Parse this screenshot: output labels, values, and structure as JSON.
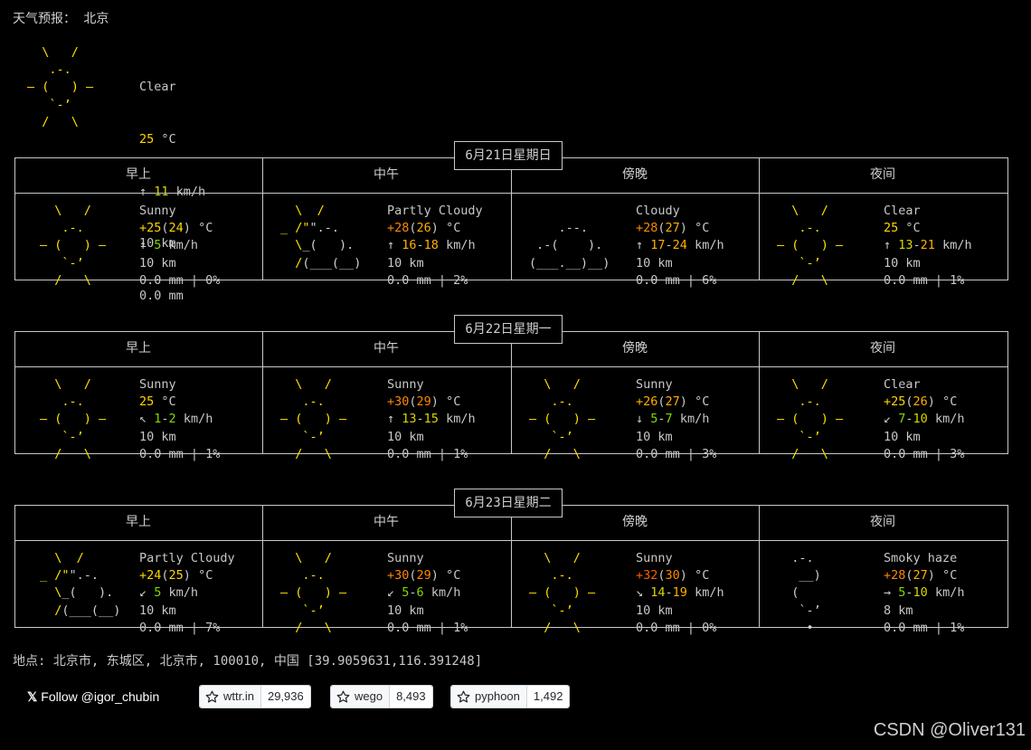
{
  "title": "天气预报： 北京",
  "current": {
    "art": [
      "  \\   /  ",
      "   .-.   ",
      "― (   ) ―",
      "   `-’   ",
      "  /   \\  "
    ],
    "condition": "Clear",
    "temp": "25",
    "temp_unit": " °C",
    "wind_arrow": "↑ ",
    "wind": "11",
    "wind_unit": " km/h",
    "visibility": "10 km",
    "precip": "0.0 mm"
  },
  "periods": [
    "早上",
    "中午",
    "傍晚",
    "夜间"
  ],
  "days": [
    {
      "date": "6月21日星期日",
      "slots": [
        {
          "art": [
            "  \\   /  ",
            "   .-.   ",
            "― (   ) ―",
            "   `-’   ",
            "  /   \\  "
          ],
          "art_color": "yellow",
          "cond": "Sunny",
          "t1": "+25",
          "t2": "24",
          "t1c": "c-t25",
          "t2c": "c-t24",
          "unit": " °C",
          "arrow": "↑ ",
          "w1": "5",
          "w2": "",
          "wc1": "w-lo",
          "wc2": "",
          "wunit": " km/h",
          "vis": "10 km",
          "prec": "0.0 mm | 0%"
        },
        {
          "art": [
            "  \\  /      ",
            "_ /\"\".-.    ",
            "  \\_(   ).  ",
            "  /(___(__) ",
            "            "
          ],
          "art_color": "mixed",
          "cond": "Partly Cloudy",
          "t1": "+28",
          "t2": "26",
          "t1c": "c-t28",
          "t2c": "c-t26",
          "unit": " °C",
          "arrow": "↑ ",
          "w1": "16",
          "w2": "18",
          "wc1": "w-hi",
          "wc2": "w-hi",
          "wunit": " km/h",
          "vis": "10 km",
          "prec": "0.0 mm | 2%"
        },
        {
          "art": [
            "            ",
            "    .--.    ",
            " .-(    ).  ",
            "(___.__)__) ",
            "            "
          ],
          "art_color": "white",
          "cond": "Cloudy",
          "t1": "+28",
          "t2": "27",
          "t1c": "c-t28",
          "t2c": "c-t27",
          "unit": " °C",
          "arrow": "↑ ",
          "w1": "17",
          "w2": "24",
          "wc1": "w-hi",
          "wc2": "w-hi",
          "wunit": " km/h",
          "vis": "10 km",
          "prec": "0.0 mm | 6%"
        },
        {
          "art": [
            "  \\   /  ",
            "   .-.   ",
            "― (   ) ―",
            "   `-’   ",
            "  /   \\  "
          ],
          "art_color": "yellow",
          "cond": "Clear",
          "t1": "25",
          "t2": "",
          "t1c": "c-t25",
          "t2c": "",
          "unit": " °C",
          "arrow": "↑ ",
          "w1": "13",
          "w2": "21",
          "wc1": "w-mid",
          "wc2": "w-hi",
          "wunit": " km/h",
          "vis": "10 km",
          "prec": "0.0 mm | 1%"
        }
      ]
    },
    {
      "date": "6月22日星期一",
      "slots": [
        {
          "art": [
            "  \\   /  ",
            "   .-.   ",
            "― (   ) ―",
            "   `-’   ",
            "  /   \\  "
          ],
          "art_color": "yellow",
          "cond": "Sunny",
          "t1": "25",
          "t2": "",
          "t1c": "c-t25",
          "t2c": "",
          "unit": " °C",
          "arrow": "↖ ",
          "w1": "1",
          "w2": "2",
          "wc1": "w-lo",
          "wc2": "w-lo",
          "wunit": " km/h",
          "vis": "10 km",
          "prec": "0.0 mm | 1%"
        },
        {
          "art": [
            "  \\   /  ",
            "   .-.   ",
            "― (   ) ―",
            "   `-’   ",
            "  /   \\  "
          ],
          "art_color": "yellow",
          "cond": "Sunny",
          "t1": "+30",
          "t2": "29",
          "t1c": "c-t30",
          "t2c": "c-t29",
          "unit": " °C",
          "arrow": "↑ ",
          "w1": "13",
          "w2": "15",
          "wc1": "w-mid",
          "wc2": "w-mid",
          "wunit": " km/h",
          "vis": "10 km",
          "prec": "0.0 mm | 1%"
        },
        {
          "art": [
            "  \\   /  ",
            "   .-.   ",
            "― (   ) ―",
            "   `-’   ",
            "  /   \\  "
          ],
          "art_color": "yellow",
          "cond": "Sunny",
          "t1": "+26",
          "t2": "27",
          "t1c": "c-t26",
          "t2c": "c-t27",
          "unit": " °C",
          "arrow": "↓ ",
          "w1": "5",
          "w2": "7",
          "wc1": "w-lo",
          "wc2": "w-lo",
          "wunit": " km/h",
          "vis": "10 km",
          "prec": "0.0 mm | 3%"
        },
        {
          "art": [
            "  \\   /  ",
            "   .-.   ",
            "― (   ) ―",
            "   `-’   ",
            "  /   \\  "
          ],
          "art_color": "yellow",
          "cond": "Clear",
          "t1": "+25",
          "t2": "26",
          "t1c": "c-t25",
          "t2c": "c-t26",
          "unit": " °C",
          "arrow": "↙ ",
          "w1": "7",
          "w2": "10",
          "wc1": "w-lo",
          "wc2": "w-mid",
          "wunit": " km/h",
          "vis": "10 km",
          "prec": "0.0 mm | 3%"
        }
      ]
    },
    {
      "date": "6月23日星期二",
      "slots": [
        {
          "art": [
            "  \\  /      ",
            "_ /\"\".-.    ",
            "  \\_(   ).  ",
            "  /(___(__) ",
            "            "
          ],
          "art_color": "mixed",
          "cond": "Partly Cloudy",
          "t1": "+24",
          "t2": "25",
          "t1c": "c-t24",
          "t2c": "c-t25",
          "unit": " °C",
          "arrow": "↙ ",
          "w1": "5",
          "w2": "",
          "wc1": "w-lo",
          "wc2": "",
          "wunit": " km/h",
          "vis": "10 km",
          "prec": "0.0 mm | 7%"
        },
        {
          "art": [
            "  \\   /  ",
            "   .-.   ",
            "― (   ) ―",
            "   `-’   ",
            "  /   \\  "
          ],
          "art_color": "yellow",
          "cond": "Sunny",
          "t1": "+30",
          "t2": "29",
          "t1c": "c-t30",
          "t2c": "c-t29",
          "unit": " °C",
          "arrow": "↙ ",
          "w1": "5",
          "w2": "6",
          "wc1": "w-lo",
          "wc2": "w-lo",
          "wunit": " km/h",
          "vis": "10 km",
          "prec": "0.0 mm | 1%"
        },
        {
          "art": [
            "  \\   /  ",
            "   .-.   ",
            "― (   ) ―",
            "   `-’   ",
            "  /   \\  "
          ],
          "art_color": "yellow",
          "cond": "Sunny",
          "t1": "+32",
          "t2": "30",
          "t1c": "c-t32",
          "t2c": "c-t30",
          "unit": " °C",
          "arrow": "↘ ",
          "w1": "14",
          "w2": "19",
          "wc1": "w-mid",
          "wc2": "w-hi",
          "wunit": " km/h",
          "vis": "10 km",
          "prec": "0.0 mm | 0%"
        },
        {
          "art": [
            "  .-.    ",
            "   __)   ",
            "  (      ",
            "   `-’   ",
            "    •    "
          ],
          "art_color": "white",
          "cond": "Smoky haze",
          "t1": "+28",
          "t2": "27",
          "t1c": "c-t28",
          "t2c": "c-t27",
          "unit": " °C",
          "arrow": "→ ",
          "w1": "5",
          "w2": "10",
          "wc1": "w-lo",
          "wc2": "w-mid",
          "wunit": " km/h",
          "vis": "8 km",
          "prec": "0.0 mm | 1%"
        }
      ]
    }
  ],
  "location": "地点: 北京市, 东城区, 北京市, 100010, 中国 [39.9059631,116.391248]",
  "footer": {
    "follow": "Follow @igor_chubin",
    "x_glyph": "𝕏",
    "repos": [
      {
        "name": "wttr.in",
        "count": "29,936"
      },
      {
        "name": "wego",
        "count": "8,493"
      },
      {
        "name": "pyphoon",
        "count": "1,492"
      }
    ]
  },
  "watermark": "CSDN @Oliver131"
}
